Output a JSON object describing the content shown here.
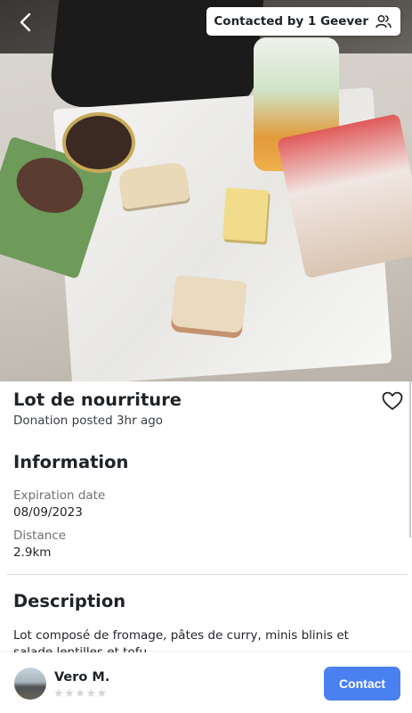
{
  "header": {
    "contacted_label": "Contacted by 1 Geever"
  },
  "listing": {
    "title": "Lot de nourriture",
    "posted": "Donation posted 3hr ago",
    "photo_icon": "food-photo"
  },
  "information": {
    "heading": "Information",
    "expiration_label": "Expiration date",
    "expiration_value": "08/09/2023",
    "distance_label": "Distance",
    "distance_value": "2.9km"
  },
  "description": {
    "heading": "Description",
    "text": "Lot composé de fromage, pâtes de curry, minis blinis et salade lentilles et tofu"
  },
  "footer": {
    "user_name": "Vero M.",
    "rating_stars": "★★★★★",
    "contact_label": "Contact",
    "accent_color": "#4a80f0"
  },
  "icons": {
    "back": "back-arrow-icon",
    "users": "users-icon",
    "favorite": "heart-icon",
    "star": "star-icon"
  }
}
